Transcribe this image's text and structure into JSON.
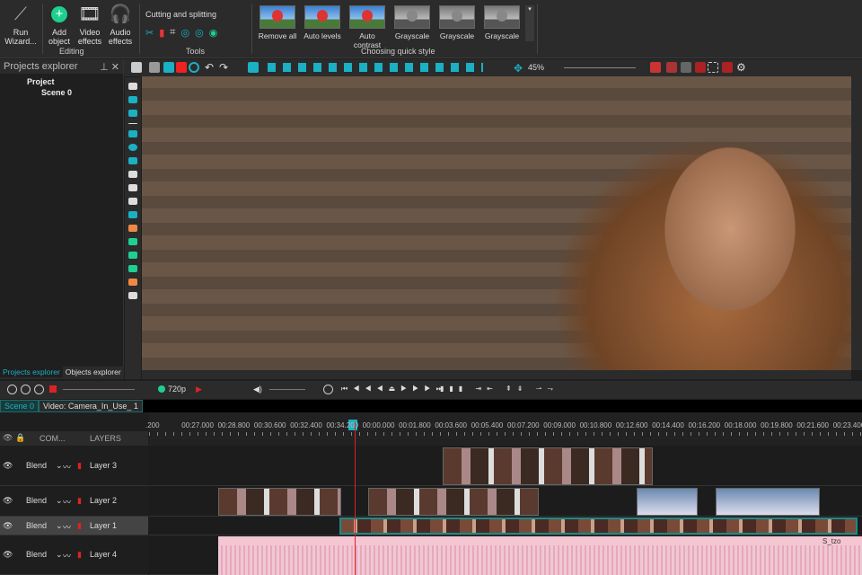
{
  "ribbon": {
    "run_wizard": "Run Wizard...",
    "add_object": "Add object",
    "video_effects": "Video effects",
    "audio_effects": "Audio effects",
    "editing_group": "Editing",
    "cutting": "Cutting and splitting",
    "tools_group": "Tools",
    "quick_styles": [
      "Remove all",
      "Auto levels",
      "Auto contrast",
      "Grayscale",
      "Grayscale",
      "Grayscale"
    ],
    "quick_style_group": "Choosing quick style"
  },
  "projects": {
    "title": "Projects explorer",
    "project": "Project",
    "scene": "Scene 0",
    "tab1": "Projects explorer",
    "tab2": "Objects explorer"
  },
  "editor": {
    "zoom": "45%"
  },
  "timeline": {
    "resolution": "720p",
    "tabs": [
      "Scene 0",
      "Video: Camera_In_Use_ 1"
    ],
    "ticks": [
      ".200",
      "00:27.000",
      "00:28.800",
      "00:30.600",
      "00:32.400",
      "00:34.200",
      "00:00.000",
      "00:01.800",
      "00:03.600",
      "00:05.400",
      "00:07.200",
      "00:09.000",
      "00:10.800",
      "00:12.600",
      "00:14.400",
      "00:16.200",
      "00:18.000",
      "00:19.800",
      "00:21.600",
      "00:23.400"
    ],
    "header": {
      "com": "COM...",
      "layers": "LAYERS"
    },
    "layers": [
      {
        "blend": "Blend",
        "name": "Layer 3"
      },
      {
        "blend": "Blend",
        "name": "Layer 2"
      },
      {
        "blend": "Blend",
        "name": "Layer 1"
      },
      {
        "blend": "Blend",
        "name": "Layer 4"
      }
    ],
    "audio_label": "S_tzo"
  },
  "colors": {
    "accent": "#1bb0c4",
    "playhead": "#dd2222"
  }
}
